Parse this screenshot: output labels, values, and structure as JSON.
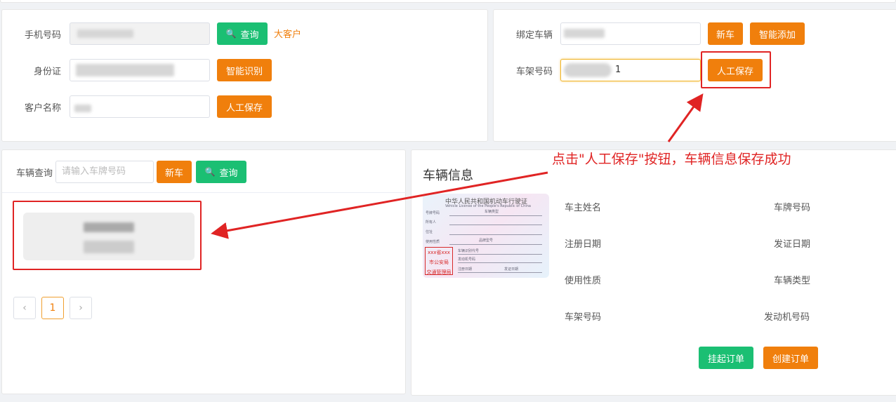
{
  "customer_panel": {
    "phone_label": "手机号码",
    "id_label": "身份证",
    "name_label": "客户名称",
    "query_button": "查询",
    "vip_link": "大客户",
    "smart_recognize_button": "智能识别",
    "manual_save_button": "人工保存"
  },
  "vehicle_bind_panel": {
    "bind_label": "绑定车辆",
    "vin_label": "车架号码",
    "vin_value_suffix": "1",
    "new_car_button": "新车",
    "smart_add_button": "智能添加",
    "manual_save_button": "人工保存"
  },
  "vehicle_search_panel": {
    "label": "车辆查询",
    "placeholder": "请输入车牌号码",
    "new_car_button": "新车",
    "query_button": "查询",
    "pager": {
      "prev": "‹",
      "current_page": "1",
      "next": "›"
    }
  },
  "vehicle_info_panel": {
    "title": "车辆信息",
    "fields": {
      "owner": "车主姓名",
      "plate": "车牌号码",
      "register_date": "注册日期",
      "issue_date": "发证日期",
      "usage": "使用性质",
      "vehicle_type": "车辆类型",
      "vin": "车架号码",
      "engine": "发动机号码"
    },
    "hold_order_button": "挂起订单",
    "create_order_button": "创建订单",
    "license_card": {
      "title": "中华人民共和国机动车行驶证",
      "subtitle": "Vehicle License of the People's Republic of China",
      "plate_no": "号牌号码",
      "vehicle_type": "车辆类型",
      "owner": "所有人",
      "address": "住址",
      "use_character": "使用性质",
      "model": "品牌型号",
      "vin": "车辆识别代号",
      "engine_no": "发动机号码",
      "register_date": "注册日期",
      "issue_date": "发证日期",
      "stamp_line1": "xxx省xxx",
      "stamp_line2": "市公安局",
      "stamp_line3": "交通管理局"
    }
  },
  "annotation": {
    "text": "点击\"人工保存\"按钮，车辆信息保存成功"
  },
  "colors": {
    "orange": "#f07f0c",
    "green": "#1bbf73",
    "annotation_red": "#e02424"
  }
}
